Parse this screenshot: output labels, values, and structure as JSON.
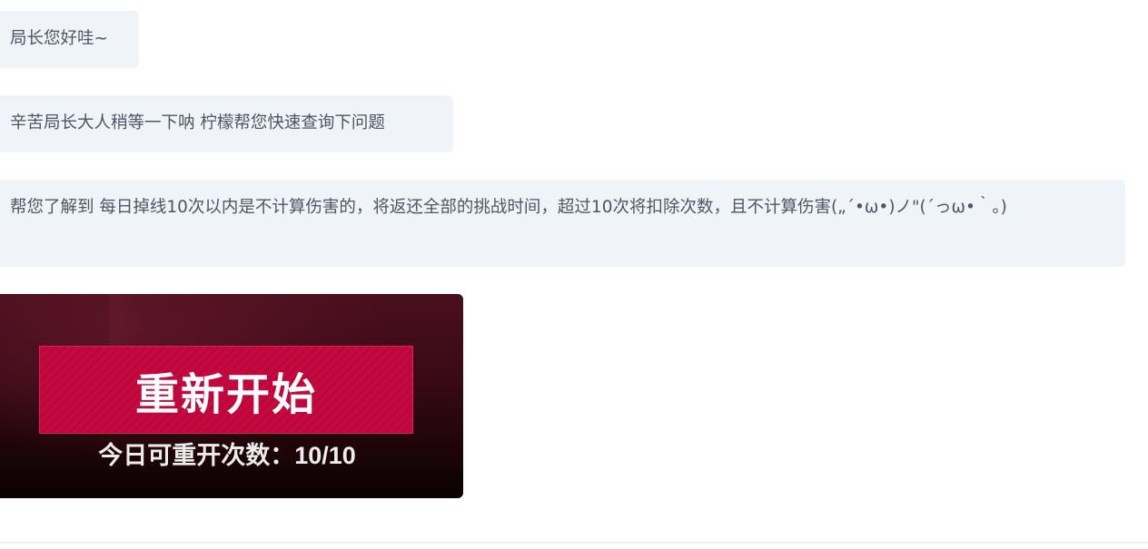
{
  "messages": [
    {
      "text": "局长您好哇~"
    },
    {
      "text": "辛苦局长大人稍等一下呐 柠檬帮您快速查询下问题"
    },
    {
      "text": "帮您了解到 每日掉线10次以内是不计算伤害的，将返还全部的挑战时间，超过10次将扣除次数，且不计算伤害(„´•ω•)ノ\"(´っω•｀。)"
    }
  ],
  "image_message": {
    "button_label": "重新开始",
    "restart_count_text": "今日可重开次数：10/10",
    "colors": {
      "button": "#c3093f",
      "background_top": "#4a0e1e",
      "background_bottom": "#0a0203"
    }
  },
  "colors": {
    "bubble_background": "#f0f3f7",
    "bubble_text": "#4e5566"
  }
}
